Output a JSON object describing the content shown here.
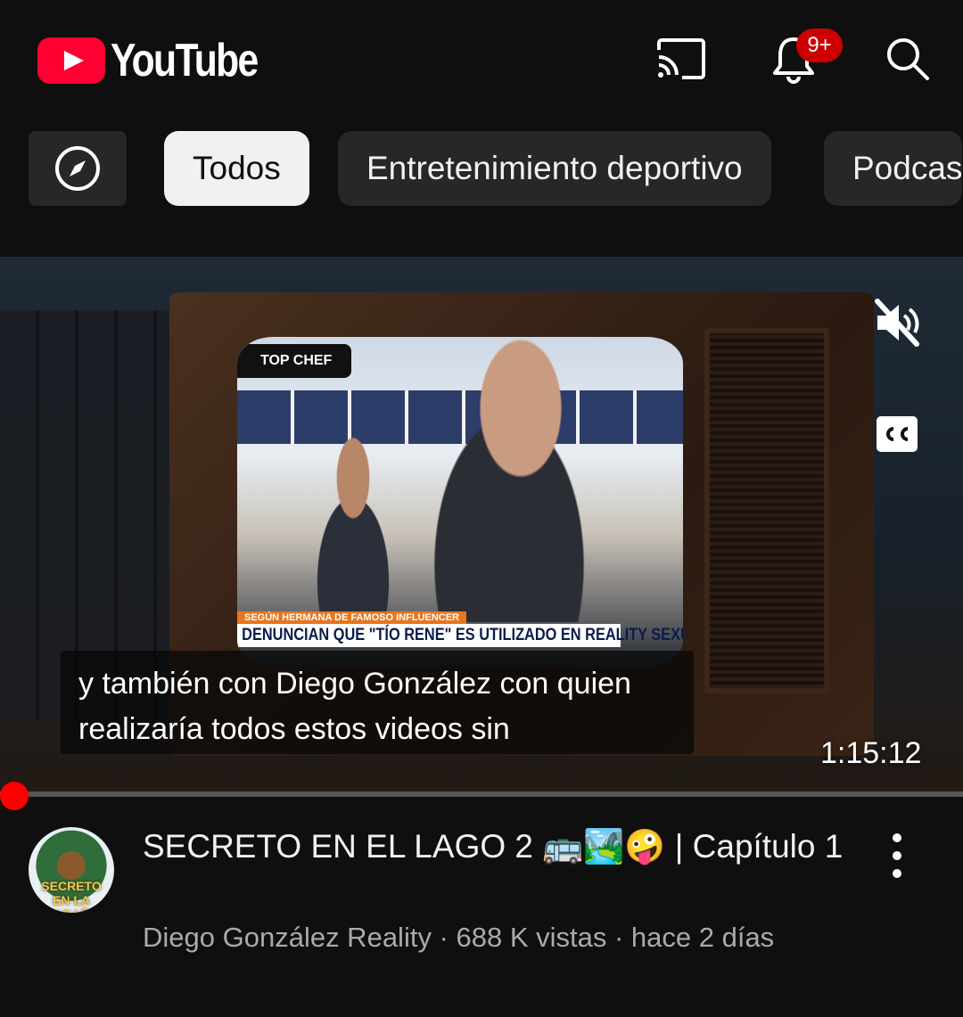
{
  "header": {
    "logo_text": "YouTube",
    "notifications_badge": "9+",
    "icons": [
      "cast-icon",
      "bell-icon",
      "search-icon"
    ]
  },
  "chips": {
    "explore_icon": "compass-icon",
    "items": [
      "Todos",
      "Entretenimiento deportivo",
      "Podcas"
    ],
    "selected": "Todos"
  },
  "player": {
    "overlay": {
      "show_logo": "TOP CHEF",
      "lower_third_top": "SEGÚN HERMANA DE FAMOSO INFLUENCER",
      "lower_third_main": "DENUNCIAN QUE \"TÍO RENE\" ES UTILIZADO EN REALITY SEXUAL"
    },
    "captions_line1": "y también con Diego González con quien",
    "captions_line2": "realizaría todos estos videos sin",
    "duration": "1:15:12",
    "progress_fraction": 0.0,
    "colors": {
      "accent": "#ff0000"
    }
  },
  "video": {
    "channel_avatar_text": "SECRETO EN LA CABAÑA",
    "title": "SECRETO EN EL LAGO 2 🚌🏞️🤪 | Capítulo 1",
    "meta": "Diego González Reality · 688 K vistas · hace 2 días"
  }
}
